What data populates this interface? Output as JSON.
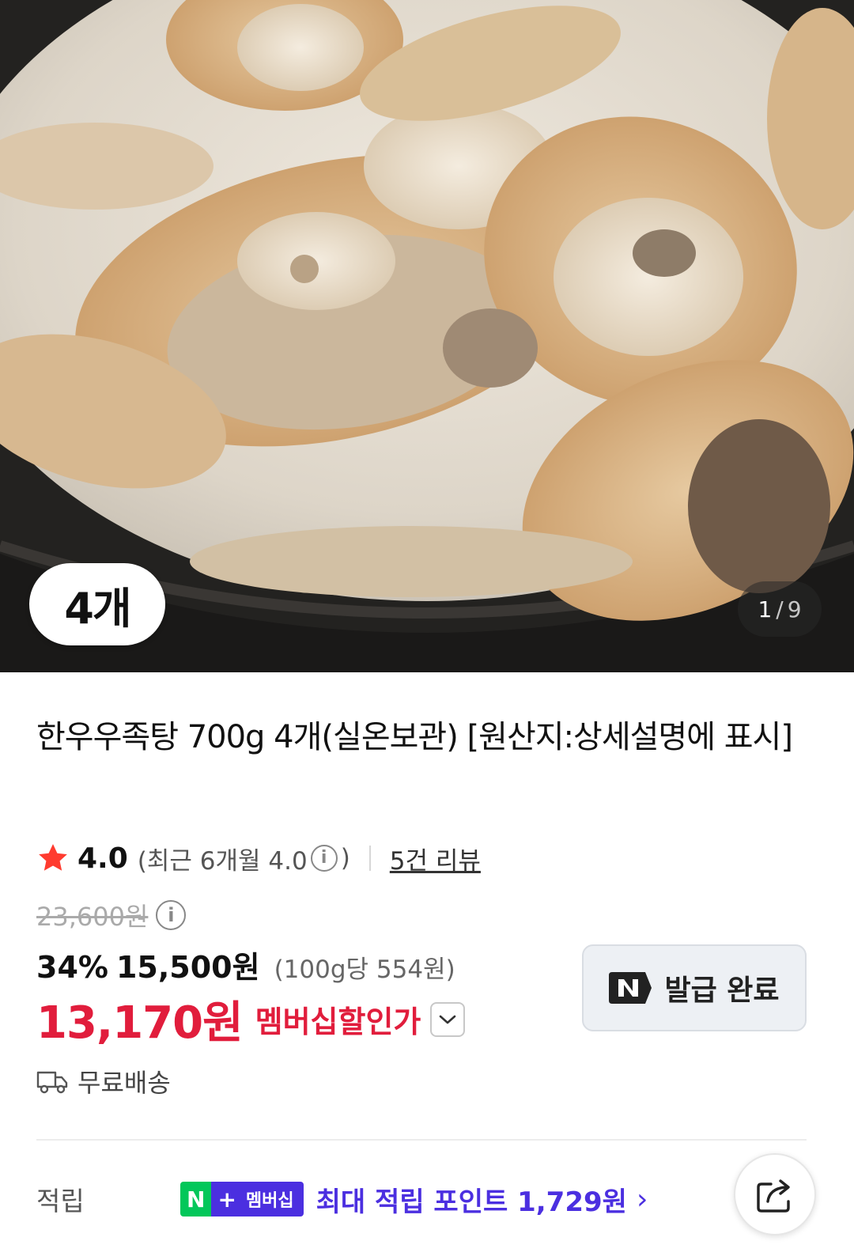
{
  "hero": {
    "image_alt": "한우우족탕",
    "quantity_badge": "4개",
    "pager": {
      "current": "1",
      "separator": "/",
      "total": "9"
    }
  },
  "product": {
    "title": "한우우족탕 700g 4개(실온보관) [원산지:상세설명에 표시]",
    "rating": {
      "star_icon": "star-icon",
      "value": "4.0",
      "recent_open": "(최근 6개월 4.0",
      "recent_close": ")",
      "review_link": "5건 리뷰"
    },
    "original_price": "23,600원",
    "discount_percent": "34%",
    "sale_price": "15,500원",
    "unit_price": "(100g당 554원)",
    "member_price": "13,170원",
    "member_label": "멤버십할인가",
    "coupon_button": {
      "icon": "naver-n-icon",
      "label": "발급 완료"
    },
    "shipping": {
      "icon": "truck-icon",
      "text": "무료배송"
    }
  },
  "points": {
    "label": "적립",
    "badge_n": "N",
    "badge_plus": "+",
    "badge_membership": "멤버십",
    "text": "최대 적립 포인트 1,729원",
    "chevron": "›"
  },
  "share": {
    "icon": "share-icon"
  },
  "colors": {
    "member_price": "#e11d3c",
    "points_purple": "#4b2fe0",
    "naver_green": "#03c75a",
    "star": "#ff3b2f"
  }
}
